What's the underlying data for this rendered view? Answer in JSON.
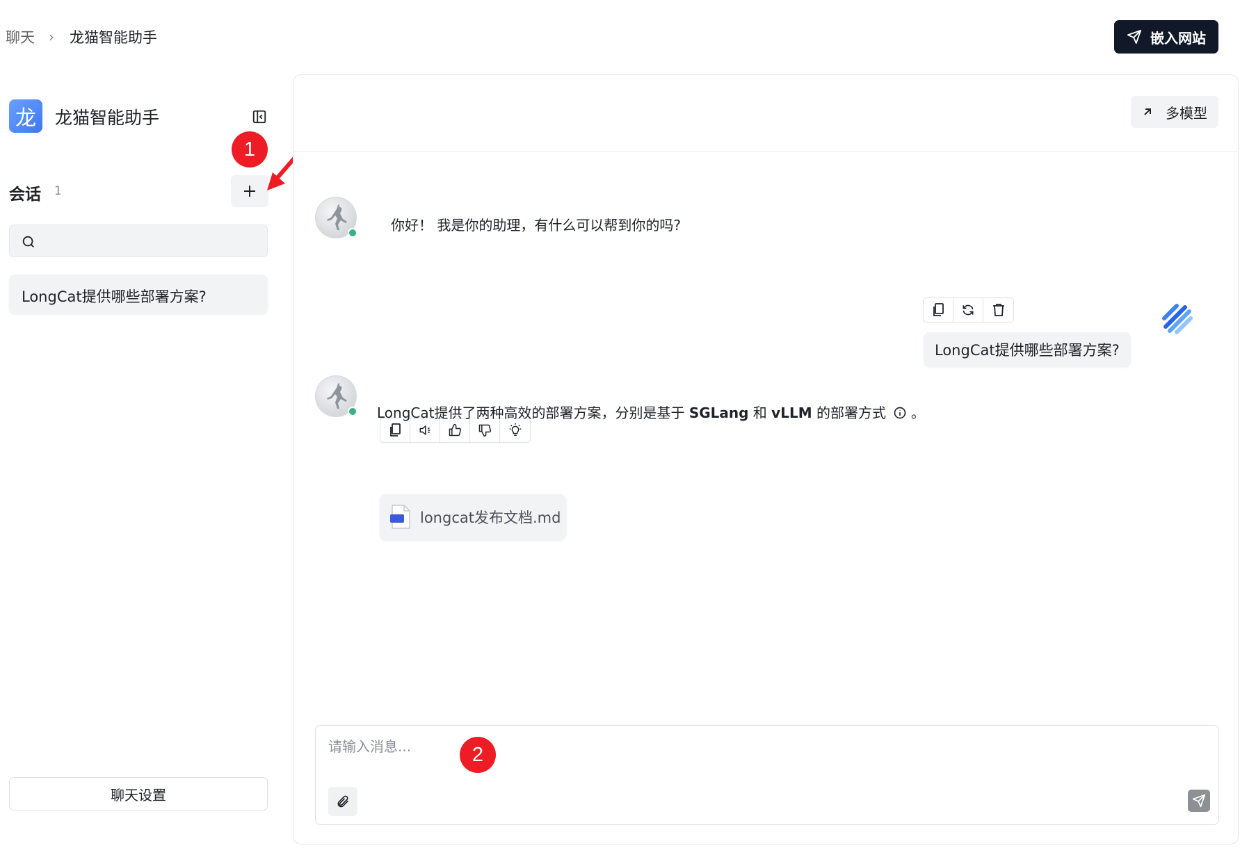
{
  "breadcrumb": {
    "parent": "聊天",
    "separator": "›",
    "current": "龙猫智能助手"
  },
  "header": {
    "embed_label": "嵌入网站"
  },
  "sidebar": {
    "logo_char": "龙",
    "app_name": "龙猫智能助手",
    "sessions_title": "会话",
    "sessions_count": "1",
    "search_placeholder": "",
    "sessions": [
      {
        "title": "LongCat提供哪些部署方案?"
      }
    ],
    "settings_label": "聊天设置"
  },
  "main": {
    "multi_model_label": "多模型",
    "messages": {
      "greeting": "你好！ 我是你的助理，有什么可以帮到你的吗?",
      "user_question": "LongCat提供哪些部署方案?",
      "answer_prefix": "LongCat提供了两种高效的部署方案，分别是基于 ",
      "answer_bold_1": "SGLang",
      "answer_mid": " 和 ",
      "answer_bold_2": "vLLM",
      "answer_suffix": " 的部署方式",
      "answer_end": "。",
      "attachment_name": "longcat发布文档.md",
      "attachment_badge": "MD"
    },
    "composer": {
      "placeholder": "请输入消息..."
    }
  },
  "annotations": {
    "badge_1": "1",
    "badge_2": "2"
  },
  "colors": {
    "accent_dark": "#111827",
    "badge_red": "#ee1c24",
    "online_green": "#36b37e",
    "logo_blue": "#4f86f7"
  },
  "icons": {
    "user_toolbar": [
      "copy-icon",
      "refresh-icon",
      "trash-icon"
    ],
    "bot_toolbar": [
      "copy-icon",
      "speaker-icon",
      "thumbs-up-icon",
      "thumbs-down-icon",
      "lightbulb-icon"
    ]
  }
}
